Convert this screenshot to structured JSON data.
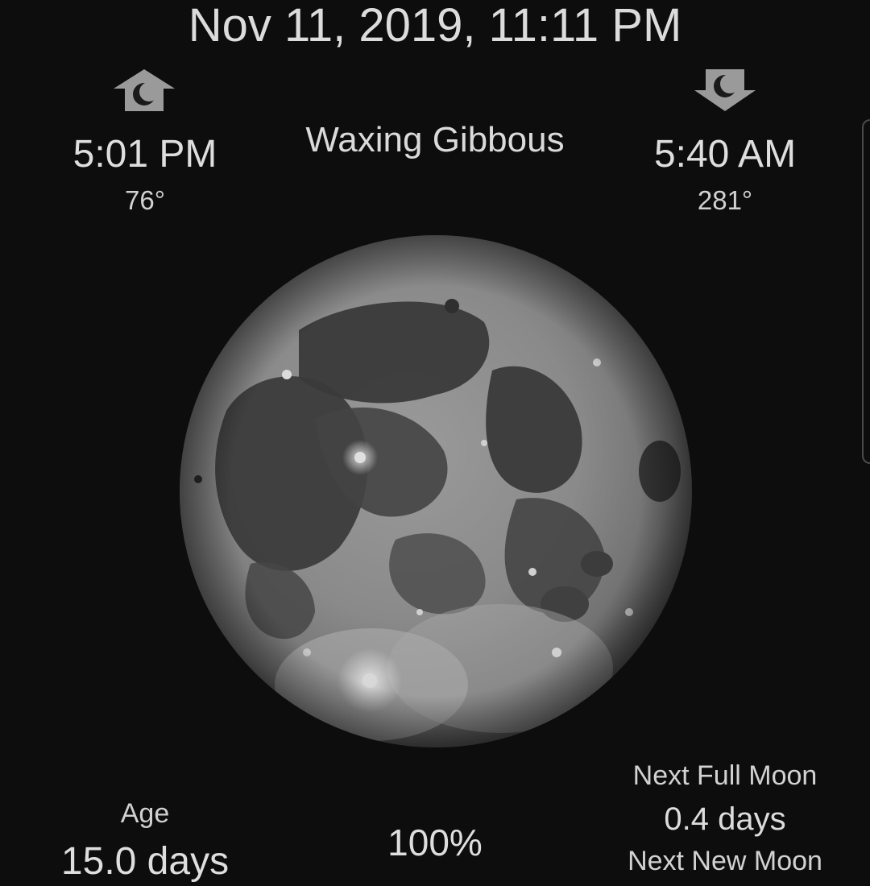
{
  "header": {
    "datetime": "Nov 11, 2019, 11:11 PM"
  },
  "moonrise": {
    "icon": "moonrise-icon",
    "time": "5:01 PM",
    "azimuth": "76°"
  },
  "moonset": {
    "icon": "moonset-icon",
    "time": "5:40 AM",
    "azimuth": "281°"
  },
  "phase": {
    "name": "Waxing Gibbous",
    "image": "full-moon-image"
  },
  "stats": {
    "age_label": "Age",
    "age_value": "15.0 days",
    "illumination": "100%",
    "next_full_label": "Next Full Moon",
    "next_full_value": "0.4 days",
    "next_new_label": "Next New Moon"
  },
  "colors": {
    "background": "#0d0d0d",
    "text": "#dcdcdc",
    "icon": "#9a9a9a"
  }
}
